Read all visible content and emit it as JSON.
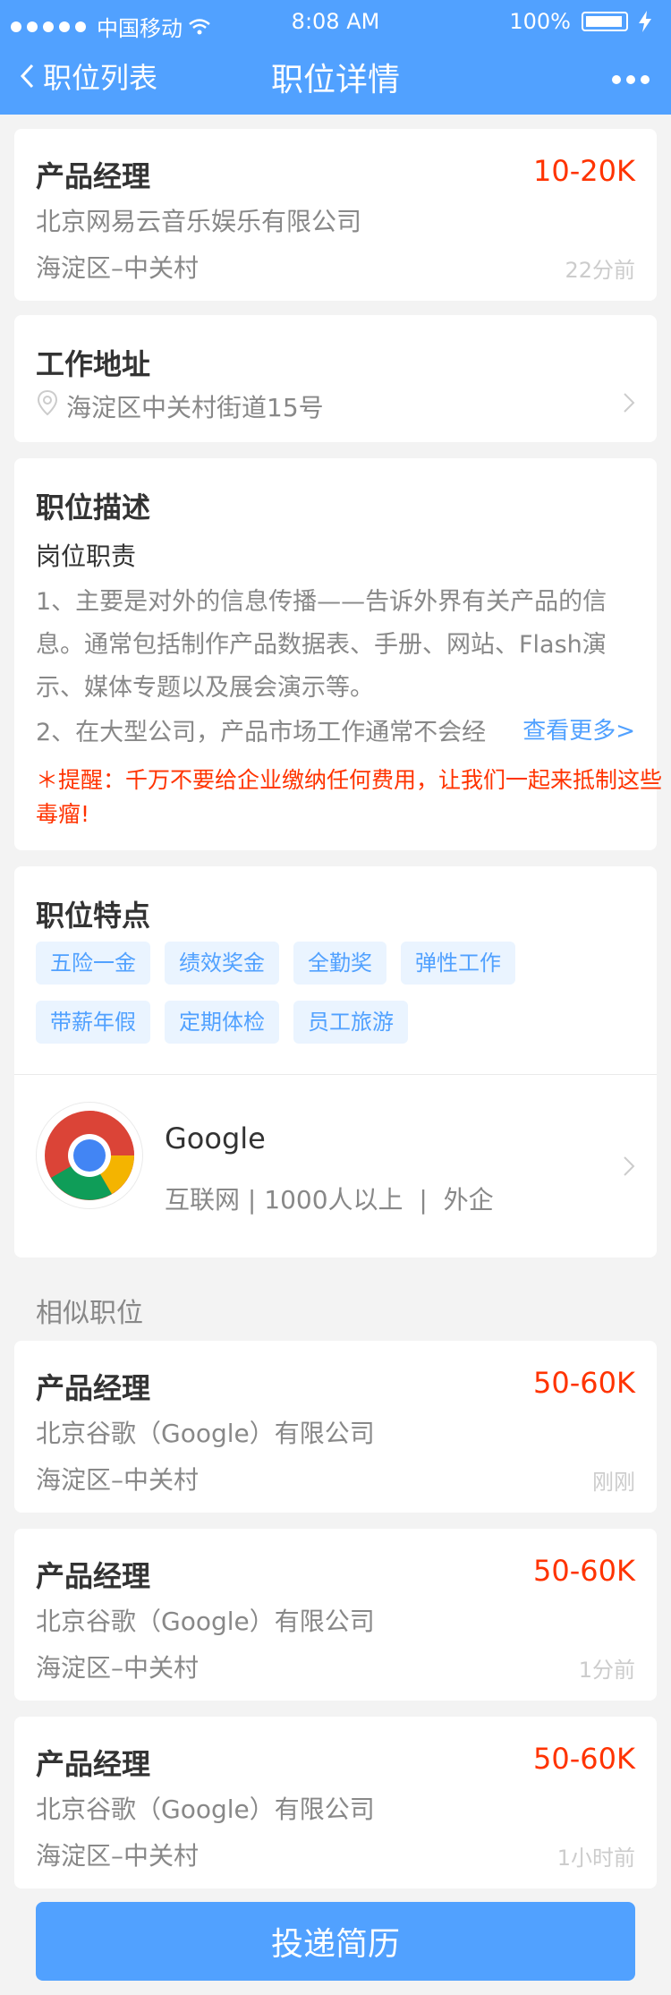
{
  "status_bar": {
    "carrier": "中国移动",
    "time": "8:08 AM",
    "battery": "100%"
  },
  "nav": {
    "back_label": "职位列表",
    "title": "职位详情"
  },
  "job": {
    "title": "产品经理",
    "salary": "10-20K",
    "company": "北京网易云音乐娱乐有限公司",
    "location": "海淀区–中关村",
    "posted": "22分前"
  },
  "address": {
    "section_title": "工作地址",
    "text": "海淀区中关村街道15号"
  },
  "description": {
    "section_title": "职位描述",
    "sub_title": "岗位职责",
    "para1_line1": "1、主要是对外的信息传播——告诉外界有关产品的信",
    "para1_line2": "息。通常包括制作产品数据表、手册、网站、Flash演",
    "para1_line3": "示、媒体专题以及展会演示等。",
    "para2": "2、在大型公司，产品市场工作通常不会经",
    "see_more": "查看更多>",
    "warning_line1": "＊提醒：千万不要给企业缴纳任何费用，让我们一起来抵制这些",
    "warning_line2": "毒瘤!"
  },
  "features": {
    "section_title": "职位特点",
    "tags": [
      "五险一金",
      "绩效奖金",
      "全勤奖",
      "弹性工作",
      "带薪年假",
      "定期体检",
      "员工旅游"
    ]
  },
  "company_card": {
    "name": "Google",
    "industry": "互联网",
    "size": "1000人以上",
    "type": "外企"
  },
  "similar": {
    "section_title": "相似职位",
    "items": [
      {
        "title": "产品经理",
        "salary": "50-60K",
        "company": "北京谷歌（Google）有限公司",
        "location": "海淀区–中关村",
        "posted": "刚刚"
      },
      {
        "title": "产品经理",
        "salary": "50-60K",
        "company": "北京谷歌（Google）有限公司",
        "location": "海淀区–中关村",
        "posted": "1分前"
      },
      {
        "title": "产品经理",
        "salary": "50-60K",
        "company": "北京谷歌（Google）有限公司",
        "location": "海淀区–中关村",
        "posted": "1小时前"
      }
    ]
  },
  "apply_button": "投递简历",
  "colors": {
    "primary": "#51A1FF",
    "salary": "#FF3300",
    "text_dark": "#333333",
    "text_gray": "#888888",
    "text_light": "#CCCCCC"
  }
}
